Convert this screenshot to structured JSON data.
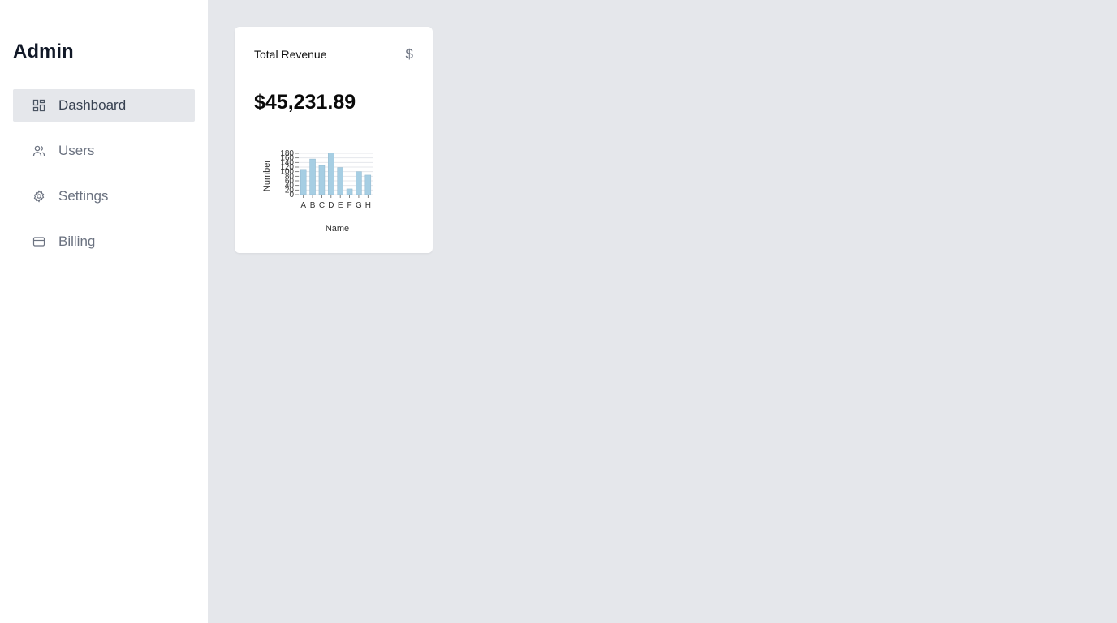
{
  "sidebar": {
    "brand": "Admin",
    "items": [
      {
        "label": "Dashboard",
        "icon": "dashboard-icon",
        "active": true
      },
      {
        "label": "Users",
        "icon": "users-icon",
        "active": false
      },
      {
        "label": "Settings",
        "icon": "gear-icon",
        "active": false
      },
      {
        "label": "Billing",
        "icon": "credit-card-icon",
        "active": false
      }
    ]
  },
  "card": {
    "title": "Total Revenue",
    "icon": "dollar-icon",
    "icon_glyph": "$",
    "value": "$45,231.89"
  },
  "colors": {
    "bar": "#a6cee3",
    "bar_stroke": "#8fb6cc",
    "active_bg": "#e5e7eb",
    "page_bg": "#e5e7eb"
  },
  "chart_data": {
    "type": "bar",
    "categories": [
      "A",
      "B",
      "C",
      "D",
      "E",
      "F",
      "G",
      "H"
    ],
    "values": [
      110,
      155,
      127,
      182,
      118,
      25,
      100,
      85
    ],
    "xlabel": "Name",
    "ylabel": "Number",
    "ylim": [
      0,
      180
    ],
    "yticks": [
      0,
      20,
      40,
      60,
      80,
      100,
      120,
      140,
      160,
      180
    ],
    "grid": true
  }
}
